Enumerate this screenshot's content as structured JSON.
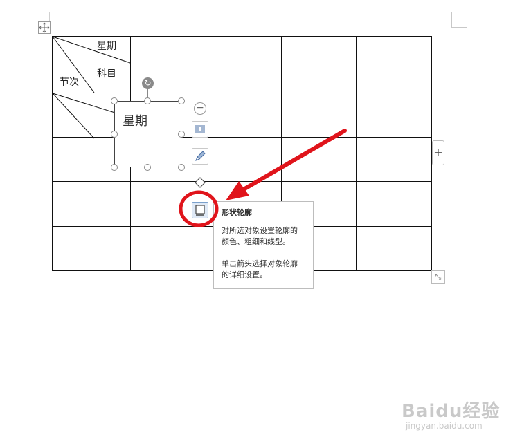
{
  "table": {
    "header_cell": {
      "top_label": "星期",
      "middle_label": "科目",
      "bottom_label": "节次"
    }
  },
  "textbox": {
    "text": "星期"
  },
  "toolbar": {
    "items": [
      {
        "icon": "text-wrap-icon"
      },
      {
        "icon": "fill-brush-icon"
      },
      {
        "icon": "shape-fill-icon"
      },
      {
        "icon": "shape-outline-icon",
        "active": true
      }
    ]
  },
  "tooltip": {
    "title": "形状轮廓",
    "line1": "对所选对象设置轮廓的",
    "line2": "颜色、粗细和线型。",
    "line3": "单击箭头选择对象轮廓",
    "line4": "的详细设置。"
  },
  "watermark": {
    "logo": "Baidu经验",
    "sub": "jingyan.baidu.com"
  },
  "colors": {
    "annotation": "#e0141b",
    "selection_accent": "#7aa0cc"
  }
}
